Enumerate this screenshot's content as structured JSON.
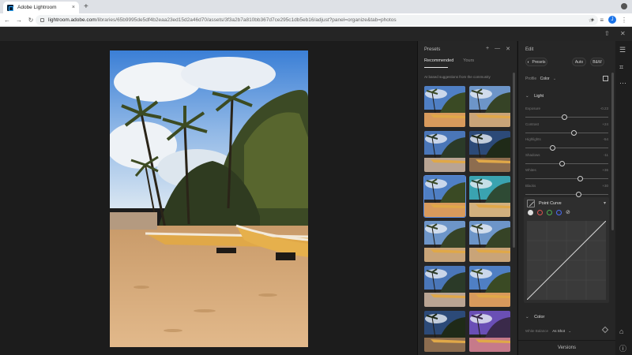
{
  "browser": {
    "tab_title": "Adobe Lightroom",
    "tab_close": "×",
    "new_tab": "+",
    "nav_back": "←",
    "nav_forward": "→",
    "nav_reload": "↻",
    "url_host": "lightroom.adobe.com",
    "url_path": "/libraries/65b9995de5df4b2eaa23ed15d2a46d70/assets/3f3a2b7a810bb367d7ce295c1db5eb16/adjust?panel=organize&tab=photos",
    "avatar_letter": "J"
  },
  "presets": {
    "title": "Presets",
    "tabs": [
      "Recommended",
      "Yours"
    ],
    "hint": "AI based suggestions from the community",
    "thumbs": [
      {
        "tone": "warm"
      },
      {
        "tone": "neutral"
      },
      {
        "tone": "cool"
      },
      {
        "tone": "dark"
      },
      {
        "tone": "warm"
      },
      {
        "tone": "teal"
      },
      {
        "tone": "neutral"
      },
      {
        "tone": "neutral"
      },
      {
        "tone": "cool"
      },
      {
        "tone": "warm"
      },
      {
        "tone": "dark"
      },
      {
        "tone": "purple"
      }
    ],
    "selected_index": 4
  },
  "edit": {
    "title": "Edit",
    "presets_button": "Presets",
    "auto_button": "Auto",
    "bw_button": "B&W",
    "profile_label": "Profile",
    "profile_value": "Color",
    "light_section": "Light",
    "sliders": [
      {
        "label": "Exposure",
        "value": "-0.23",
        "pos": 0.47
      },
      {
        "label": "Contrast",
        "value": "+24",
        "pos": 0.59
      },
      {
        "label": "Highlights",
        "value": "-54",
        "pos": 0.33
      },
      {
        "label": "Shadows",
        "value": "-11",
        "pos": 0.44
      },
      {
        "label": "Whites",
        "value": "+36",
        "pos": 0.66
      },
      {
        "label": "Blacks",
        "value": "+30",
        "pos": 0.64
      }
    ],
    "curve_title": "Point Curve",
    "color_section": "Color",
    "white_balance_label": "White Balance",
    "white_balance_value": "As Shot",
    "versions": "Versions"
  },
  "colors": {
    "accent": "#5b8de3",
    "channel_red": "#d9534f",
    "channel_green": "#4caf50",
    "channel_blue": "#4a6cf7"
  }
}
